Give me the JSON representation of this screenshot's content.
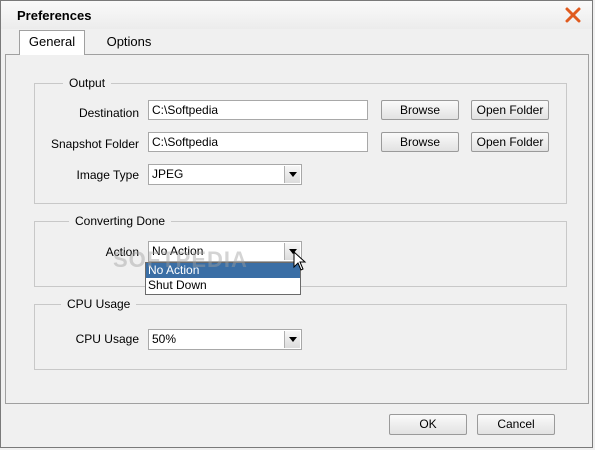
{
  "window": {
    "title": "Preferences"
  },
  "tabs": [
    {
      "label": "General",
      "active": true
    },
    {
      "label": "Options",
      "active": false
    }
  ],
  "output": {
    "legend": "Output",
    "destination_label": "Destination",
    "destination_value": "C:\\Softpedia",
    "snapshot_label": "Snapshot Folder",
    "snapshot_value": "C:\\Softpedia",
    "browse_label": "Browse",
    "open_folder_label": "Open Folder",
    "image_type_label": "Image Type",
    "image_type_value": "JPEG"
  },
  "converting": {
    "legend": "Converting Done",
    "action_label": "Action",
    "action_value": "No Action",
    "options": [
      "No Action",
      "Shut Down"
    ],
    "highlighted": "No Action"
  },
  "cpu": {
    "legend": "CPU Usage",
    "label": "CPU Usage",
    "value": "50%"
  },
  "footer": {
    "ok_label": "OK",
    "cancel_label": "Cancel"
  },
  "watermark": "SOFTPEDIA",
  "colors": {
    "close_icon": "#e05a1e",
    "selection": "#3a6ea5"
  },
  "icons": {
    "close": "close-icon",
    "dropdown": "chevron-down-icon",
    "cursor": "mouse-pointer-icon"
  }
}
